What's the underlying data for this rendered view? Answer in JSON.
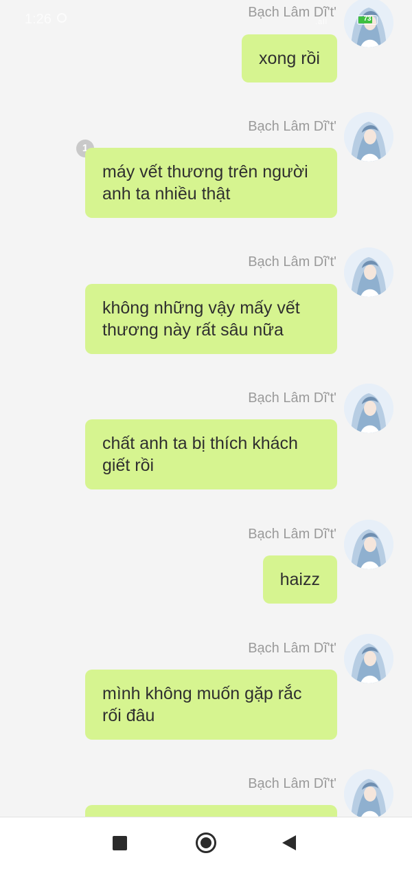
{
  "status_bar": {
    "time": "1:26",
    "signal": ".all",
    "battery_level": "73"
  },
  "messages": [
    {
      "sender": "Bạch Lâm Dĩ't'",
      "text": "xong rồi"
    },
    {
      "sender": "Bạch Lâm Dĩ't'",
      "text": "máy vết thương trên người anh ta nhiều thật",
      "unread": "1"
    },
    {
      "sender": "Bạch Lâm Dĩ't'",
      "text": "không những vậy mấy vết thương này rất sâu nữa"
    },
    {
      "sender": "Bạch Lâm Dĩ't'",
      "text": "chất anh ta bị thích khách giết rồi"
    },
    {
      "sender": "Bạch Lâm Dĩ't'",
      "text": "haizz"
    },
    {
      "sender": "Bạch Lâm Dĩ't'",
      "text": "mình không muốn gặp rắc rối đâu"
    },
    {
      "sender": "Bạch Lâm Dĩ't'",
      "text": ""
    }
  ],
  "colors": {
    "bubble": "#d6f490",
    "background": "#f4f4f4",
    "name_text": "#9a9a9a"
  },
  "icons": {
    "recent_apps": "square-icon",
    "home": "circle-home-icon",
    "back": "triangle-back-icon"
  }
}
